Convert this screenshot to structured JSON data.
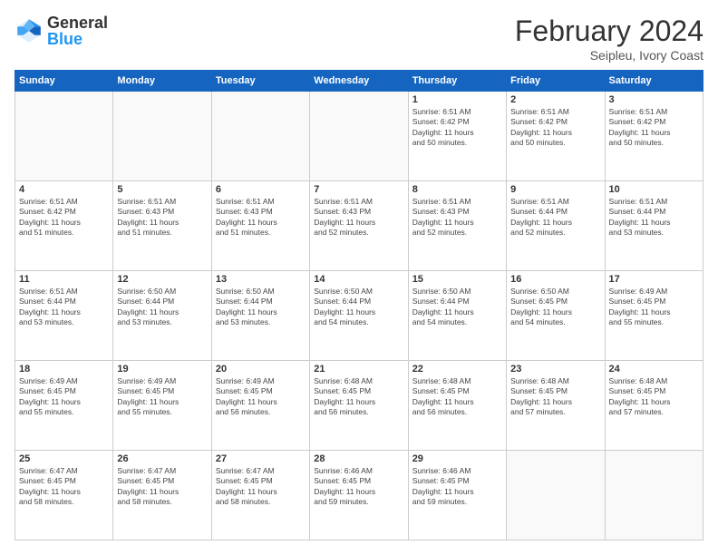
{
  "header": {
    "logo_general": "General",
    "logo_blue": "Blue",
    "title": "February 2024",
    "location": "Seipleu, Ivory Coast"
  },
  "days_of_week": [
    "Sunday",
    "Monday",
    "Tuesday",
    "Wednesday",
    "Thursday",
    "Friday",
    "Saturday"
  ],
  "weeks": [
    [
      {
        "day": "",
        "info": ""
      },
      {
        "day": "",
        "info": ""
      },
      {
        "day": "",
        "info": ""
      },
      {
        "day": "",
        "info": ""
      },
      {
        "day": "1",
        "info": "Sunrise: 6:51 AM\nSunset: 6:42 PM\nDaylight: 11 hours\nand 50 minutes."
      },
      {
        "day": "2",
        "info": "Sunrise: 6:51 AM\nSunset: 6:42 PM\nDaylight: 11 hours\nand 50 minutes."
      },
      {
        "day": "3",
        "info": "Sunrise: 6:51 AM\nSunset: 6:42 PM\nDaylight: 11 hours\nand 50 minutes."
      }
    ],
    [
      {
        "day": "4",
        "info": "Sunrise: 6:51 AM\nSunset: 6:42 PM\nDaylight: 11 hours\nand 51 minutes."
      },
      {
        "day": "5",
        "info": "Sunrise: 6:51 AM\nSunset: 6:43 PM\nDaylight: 11 hours\nand 51 minutes."
      },
      {
        "day": "6",
        "info": "Sunrise: 6:51 AM\nSunset: 6:43 PM\nDaylight: 11 hours\nand 51 minutes."
      },
      {
        "day": "7",
        "info": "Sunrise: 6:51 AM\nSunset: 6:43 PM\nDaylight: 11 hours\nand 52 minutes."
      },
      {
        "day": "8",
        "info": "Sunrise: 6:51 AM\nSunset: 6:43 PM\nDaylight: 11 hours\nand 52 minutes."
      },
      {
        "day": "9",
        "info": "Sunrise: 6:51 AM\nSunset: 6:44 PM\nDaylight: 11 hours\nand 52 minutes."
      },
      {
        "day": "10",
        "info": "Sunrise: 6:51 AM\nSunset: 6:44 PM\nDaylight: 11 hours\nand 53 minutes."
      }
    ],
    [
      {
        "day": "11",
        "info": "Sunrise: 6:51 AM\nSunset: 6:44 PM\nDaylight: 11 hours\nand 53 minutes."
      },
      {
        "day": "12",
        "info": "Sunrise: 6:50 AM\nSunset: 6:44 PM\nDaylight: 11 hours\nand 53 minutes."
      },
      {
        "day": "13",
        "info": "Sunrise: 6:50 AM\nSunset: 6:44 PM\nDaylight: 11 hours\nand 53 minutes."
      },
      {
        "day": "14",
        "info": "Sunrise: 6:50 AM\nSunset: 6:44 PM\nDaylight: 11 hours\nand 54 minutes."
      },
      {
        "day": "15",
        "info": "Sunrise: 6:50 AM\nSunset: 6:44 PM\nDaylight: 11 hours\nand 54 minutes."
      },
      {
        "day": "16",
        "info": "Sunrise: 6:50 AM\nSunset: 6:45 PM\nDaylight: 11 hours\nand 54 minutes."
      },
      {
        "day": "17",
        "info": "Sunrise: 6:49 AM\nSunset: 6:45 PM\nDaylight: 11 hours\nand 55 minutes."
      }
    ],
    [
      {
        "day": "18",
        "info": "Sunrise: 6:49 AM\nSunset: 6:45 PM\nDaylight: 11 hours\nand 55 minutes."
      },
      {
        "day": "19",
        "info": "Sunrise: 6:49 AM\nSunset: 6:45 PM\nDaylight: 11 hours\nand 55 minutes."
      },
      {
        "day": "20",
        "info": "Sunrise: 6:49 AM\nSunset: 6:45 PM\nDaylight: 11 hours\nand 56 minutes."
      },
      {
        "day": "21",
        "info": "Sunrise: 6:48 AM\nSunset: 6:45 PM\nDaylight: 11 hours\nand 56 minutes."
      },
      {
        "day": "22",
        "info": "Sunrise: 6:48 AM\nSunset: 6:45 PM\nDaylight: 11 hours\nand 56 minutes."
      },
      {
        "day": "23",
        "info": "Sunrise: 6:48 AM\nSunset: 6:45 PM\nDaylight: 11 hours\nand 57 minutes."
      },
      {
        "day": "24",
        "info": "Sunrise: 6:48 AM\nSunset: 6:45 PM\nDaylight: 11 hours\nand 57 minutes."
      }
    ],
    [
      {
        "day": "25",
        "info": "Sunrise: 6:47 AM\nSunset: 6:45 PM\nDaylight: 11 hours\nand 58 minutes."
      },
      {
        "day": "26",
        "info": "Sunrise: 6:47 AM\nSunset: 6:45 PM\nDaylight: 11 hours\nand 58 minutes."
      },
      {
        "day": "27",
        "info": "Sunrise: 6:47 AM\nSunset: 6:45 PM\nDaylight: 11 hours\nand 58 minutes."
      },
      {
        "day": "28",
        "info": "Sunrise: 6:46 AM\nSunset: 6:45 PM\nDaylight: 11 hours\nand 59 minutes."
      },
      {
        "day": "29",
        "info": "Sunrise: 6:46 AM\nSunset: 6:45 PM\nDaylight: 11 hours\nand 59 minutes."
      },
      {
        "day": "",
        "info": ""
      },
      {
        "day": "",
        "info": ""
      }
    ]
  ]
}
